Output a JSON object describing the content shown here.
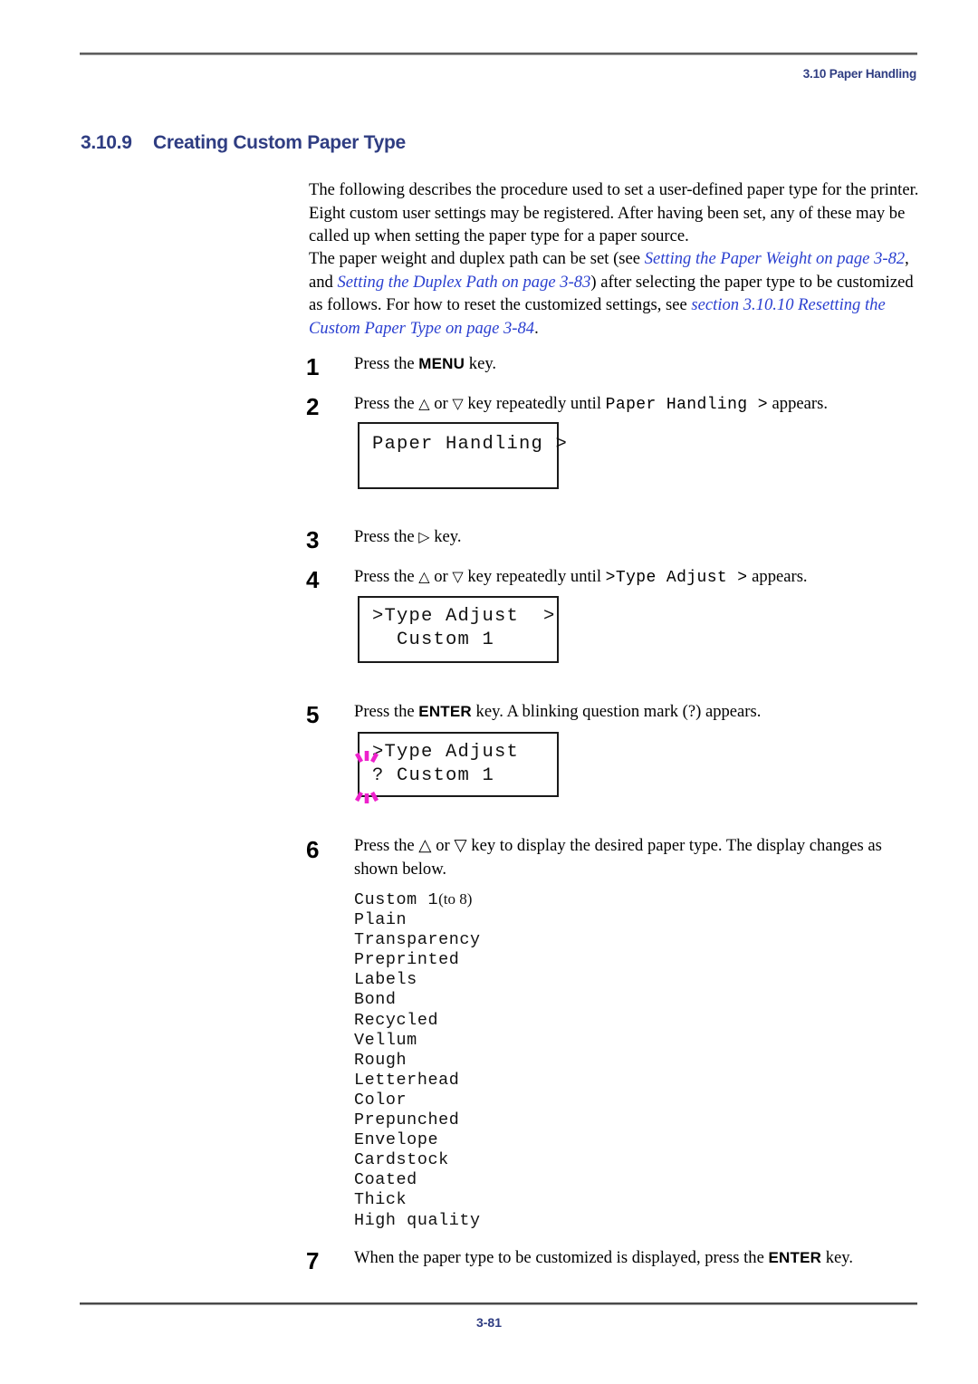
{
  "header": {
    "running_head": "3.10 Paper Handling"
  },
  "section": {
    "number": "3.10.9",
    "title": "Creating Custom Paper Type"
  },
  "paragraphs": {
    "p1": "The following describes the procedure used to set a user-defined paper type for the printer. Eight custom user settings may be registered. After having been set, any of these may be called up when setting the paper type for a paper source.",
    "p2_part1": "The paper weight and duplex path can be set (see ",
    "p2_xref1": "Setting the Paper Weight on page 3-82",
    "p2_part2": ", and ",
    "p2_xref2": "Setting the Duplex Path on page 3-83",
    "p2_part3": ") after selecting the paper type to be customized as follows. For how to reset the customized settings, see ",
    "p2_xref3": "section 3.10.10 Resetting the Custom Paper Type on page 3-84",
    "p2_part4": "."
  },
  "steps": [
    {
      "number": "1",
      "text_before": "Press the ",
      "key": "MENU",
      "text_after": " key."
    },
    {
      "number": "2",
      "text_before": "Press the ",
      "glyph_up": "△",
      "text_mid": " or ",
      "glyph_down": "▽",
      "text_mid2": " key repeatedly until ",
      "mono": "Paper Handling >",
      "text_after": " appears."
    },
    {
      "number": "3",
      "text_before": "Press the ",
      "glyph_right": "▷",
      "text_after": " key."
    },
    {
      "number": "4",
      "text_before": "Press the ",
      "glyph_up": "△",
      "text_mid": " or ",
      "glyph_down": "▽",
      "text_mid2": " key repeatedly until ",
      "mono": ">Type Adjust >",
      "text_after": " appears."
    },
    {
      "number": "5",
      "text_before": "Press the ",
      "key": "ENTER",
      "text_after": " key. A blinking question mark (?) appears."
    },
    {
      "number": "6",
      "text": "Press the △ or ▽ key to display the desired paper type. The display changes as shown below."
    },
    {
      "number": "7",
      "text_before": "When the paper type to be customized is displayed, press the ",
      "key": "ENTER",
      "text_after": " key."
    }
  ],
  "lcd_displays": [
    {
      "name": "paper-handling",
      "line1": "Paper Handling >",
      "line2": ""
    },
    {
      "name": "type-adjust",
      "line1": ">Type Adjust  >",
      "line2": "  Custom 1"
    },
    {
      "name": "type-adjust-blinking",
      "line1": ">Type Adjust",
      "line2": "? Custom 1"
    }
  ],
  "paper_types": [
    {
      "value": "Custom 1",
      "note": "(to 8)"
    },
    {
      "value": "Plain",
      "note": ""
    },
    {
      "value": "Transparency",
      "note": ""
    },
    {
      "value": "Preprinted",
      "note": ""
    },
    {
      "value": "Labels",
      "note": ""
    },
    {
      "value": "Bond",
      "note": ""
    },
    {
      "value": "Recycled",
      "note": ""
    },
    {
      "value": "Vellum",
      "note": ""
    },
    {
      "value": "Rough",
      "note": ""
    },
    {
      "value": "Letterhead",
      "note": ""
    },
    {
      "value": "Color",
      "note": ""
    },
    {
      "value": "Prepunched",
      "note": ""
    },
    {
      "value": "Envelope",
      "note": ""
    },
    {
      "value": "Cardstock",
      "note": ""
    },
    {
      "value": "Coated",
      "note": ""
    },
    {
      "value": "Thick",
      "note": ""
    },
    {
      "value": "High quality",
      "note": ""
    }
  ],
  "footer": {
    "page_number": "3-81"
  },
  "colors": {
    "heading_blue": "#2f3d82",
    "xref_blue": "#2a3fd0",
    "blink_magenta": "#ee22cc",
    "rule_gray": "#5f5f5f"
  }
}
